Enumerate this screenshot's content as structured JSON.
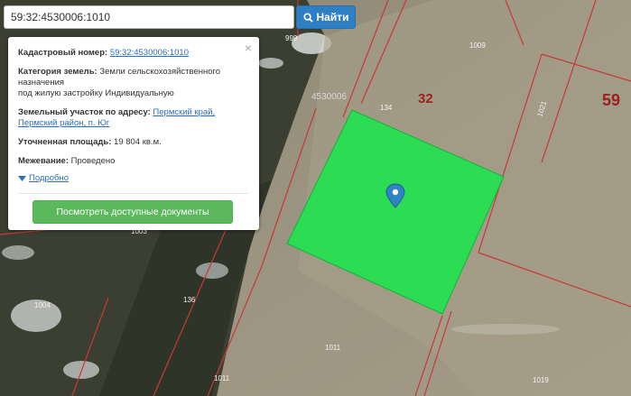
{
  "search": {
    "value": "59:32:4530006:1010",
    "button_label": "Найти"
  },
  "popup": {
    "cad_num_label": "Кадастровый номер:",
    "cad_num_value": "59:32:4530006:1010",
    "category_label": "Категория земель:",
    "category_value_1": "Земли сельскохозяйственного",
    "category_value_2": "назначения",
    "category_value_3": "под жилую застройку Индивидуальную",
    "address_label": "Земельный участок по адресу:",
    "address_link_1": "Пермский край,",
    "address_link_2": "Пермский район, п. Юг",
    "area_label": "Уточненная площадь:",
    "area_value": "19 804 кв.м.",
    "survey_label": "Межевание:",
    "survey_value": "Проведено",
    "more_label": "Подробно",
    "docs_button": "Посмотреть доступные документы",
    "close_glyph": "×"
  },
  "map": {
    "parcel_labels": [
      "999",
      "1009",
      "134",
      "1021",
      "1003",
      "1004",
      "136",
      "1011",
      "1011",
      "1019"
    ],
    "quarter_label": "4530006",
    "district_label_32": "32",
    "district_label_59": "59",
    "selected_parcel_color": "#22e34f",
    "boundary_color": "#c9373b",
    "marker_color": "#2f83c7"
  }
}
